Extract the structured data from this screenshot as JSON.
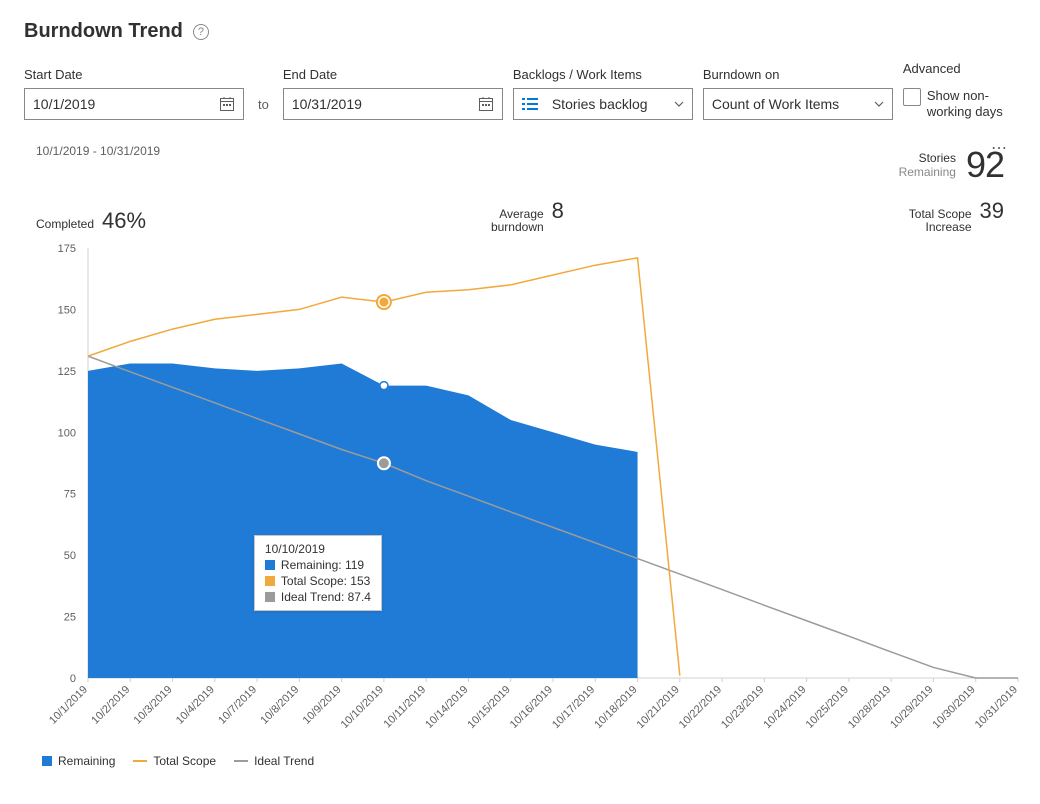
{
  "header": {
    "title": "Burndown Trend",
    "help_tooltip": "?"
  },
  "controls": {
    "start_date": {
      "label": "Start Date",
      "value": "10/1/2019"
    },
    "to_label": "to",
    "end_date": {
      "label": "End Date",
      "value": "10/31/2019"
    },
    "backlogs": {
      "label": "Backlogs / Work Items",
      "value": "Stories backlog"
    },
    "burndown_on": {
      "label": "Burndown on",
      "value": "Count of Work Items"
    },
    "advanced": {
      "label": "Advanced",
      "checkbox_label": "Show non-working days",
      "checkbox_checked": false
    }
  },
  "card": {
    "date_range": "10/1/2019 - 10/31/2019",
    "stories": {
      "label": "Stories",
      "sub": "Remaining",
      "value": "92"
    },
    "completed": {
      "label": "Completed",
      "value": "46%"
    },
    "avg_burndown": {
      "label_line1": "Average",
      "label_line2": "burndown",
      "value": "8"
    },
    "total_scope": {
      "label_line1": "Total Scope",
      "label_line2": "Increase",
      "value": "39"
    }
  },
  "tooltip": {
    "date": "10/10/2019",
    "remaining_label": "Remaining: 119",
    "scope_label": "Total Scope: 153",
    "ideal_label": "Ideal Trend: 87.4"
  },
  "legend": {
    "remaining": "Remaining",
    "scope": "Total Scope",
    "ideal": "Ideal Trend"
  },
  "chart_data": {
    "type": "area",
    "title": "Burndown Trend",
    "xlabel": "",
    "ylabel": "",
    "ylim": [
      0,
      175
    ],
    "yticks": [
      0,
      25,
      50,
      75,
      100,
      125,
      150,
      175
    ],
    "x": [
      "10/1/2019",
      "10/2/2019",
      "10/3/2019",
      "10/4/2019",
      "10/7/2019",
      "10/8/2019",
      "10/9/2019",
      "10/10/2019",
      "10/11/2019",
      "10/14/2019",
      "10/15/2019",
      "10/16/2019",
      "10/17/2019",
      "10/18/2019",
      "10/21/2019",
      "10/22/2019",
      "10/23/2019",
      "10/24/2019",
      "10/25/2019",
      "10/28/2019",
      "10/29/2019",
      "10/30/2019",
      "10/31/2019"
    ],
    "series": [
      {
        "name": "Remaining",
        "values": [
          125,
          128,
          128,
          126,
          125,
          126,
          128,
          119,
          119,
          115,
          105,
          100,
          95,
          92,
          null,
          null,
          null,
          null,
          null,
          null,
          null,
          null,
          null
        ],
        "style": "area",
        "color": "#207bd6"
      },
      {
        "name": "Total Scope",
        "values": [
          131,
          137,
          142,
          146,
          148,
          150,
          155,
          153,
          157,
          158,
          160,
          164,
          168,
          171,
          1,
          null,
          null,
          null,
          null,
          null,
          null,
          null,
          null
        ],
        "style": "line",
        "color": "#f2a93b"
      },
      {
        "name": "Ideal Trend",
        "values": [
          131,
          124.6,
          118.3,
          112,
          105.6,
          99.3,
          93,
          87.4,
          80.3,
          74,
          67.6,
          61.3,
          55,
          48.6,
          42.3,
          36,
          29.6,
          23.3,
          17,
          10.6,
          4.3,
          0,
          0
        ],
        "style": "line",
        "color": "#9b9b9b"
      }
    ],
    "highlight_index": 7,
    "highlight": {
      "date": "10/10/2019",
      "Remaining": 119,
      "Total Scope": 153,
      "Ideal Trend": 87.4
    }
  }
}
